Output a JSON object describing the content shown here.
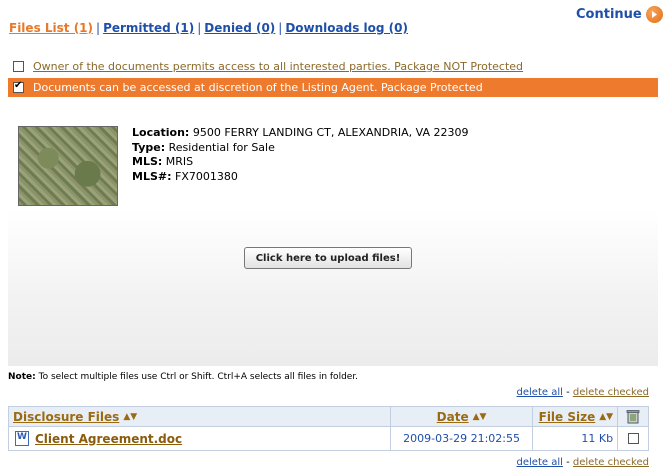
{
  "tabs": {
    "files_list": "Files List (1)",
    "permitted": "Permitted (1)",
    "denied": "Denied (0)",
    "downloads_log": "Downloads log (0)",
    "separator": "|"
  },
  "continue": {
    "label": "Continue",
    "icon": "arrow-right-circle-icon"
  },
  "options": [
    {
      "label": "Owner of the documents permits access to all interested parties. Package NOT Protected",
      "checked": false
    },
    {
      "label": "Documents can be accessed at discretion of the Listing Agent. Package Protected",
      "checked": true
    }
  ],
  "listing": {
    "location_label": "Location:",
    "location": "9500 FERRY LANDING CT, ALEXANDRIA, VA 22309",
    "type_label": "Type:",
    "type": "Residential for Sale",
    "mls_label": "MLS:",
    "mls": "MRIS",
    "mlsnum_label": "MLS#:",
    "mlsnum": "FX7001380"
  },
  "upload_button": "Click here to upload files!",
  "note": {
    "label": "Note:",
    "text": "To select multiple files use Ctrl or Shift. Ctrl+A selects all files in folder."
  },
  "actions": {
    "delete_all": "delete all",
    "separator": "-",
    "delete_checked": "delete checked"
  },
  "table": {
    "columns": [
      "Disclosure Files",
      "Date",
      "File Size"
    ],
    "rows": [
      {
        "name": "Client Agreement.doc",
        "date": "2009-03-29 21:02:55",
        "size": "11 Kb",
        "checked": false
      }
    ]
  },
  "colors": {
    "accent_orange": "#ee7a2e",
    "link_blue": "#1f4fa8",
    "link_brown": "#8b6a2a",
    "header_bg": "#e8eef6"
  }
}
